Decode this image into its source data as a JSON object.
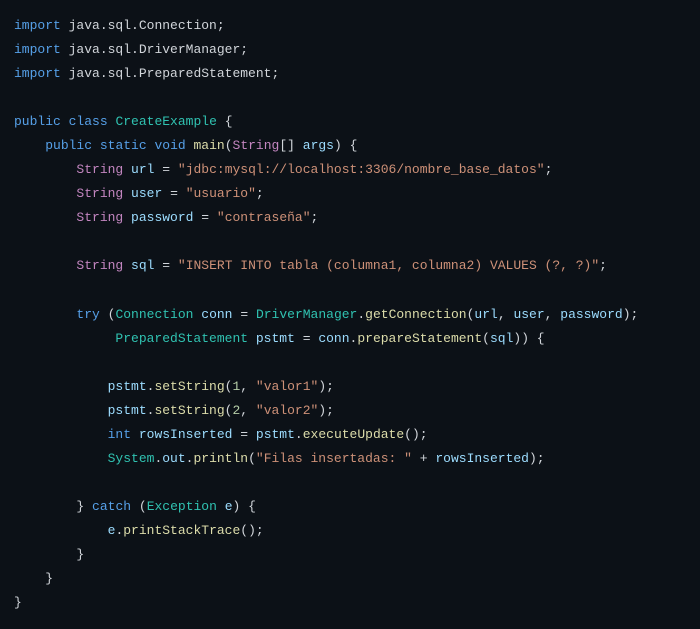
{
  "code": {
    "import1_pkg": "java.sql.Connection",
    "import2_pkg": "java.sql.DriverManager",
    "import3_pkg": "java.sql.PreparedStatement",
    "kw_import": "import",
    "kw_public": "public",
    "kw_class": "class",
    "kw_static": "static",
    "kw_void": "void",
    "kw_try": "try",
    "kw_catch": "catch",
    "kw_int": "int",
    "classname": "CreateExample",
    "main_name": "main",
    "string_type": "String",
    "args_name": "args",
    "var_url": "url",
    "var_user": "user",
    "var_password": "password",
    "var_sql": "sql",
    "var_conn": "conn",
    "var_pstmt": "pstmt",
    "var_rows": "rowsInserted",
    "var_e": "e",
    "cls_connection": "Connection",
    "cls_drivermanager": "DriverManager",
    "cls_prepstmt": "PreparedStatement",
    "cls_exception": "Exception",
    "cls_system": "System",
    "fld_out": "out",
    "m_getconn": "getConnection",
    "m_prepstmt": "prepareStatement",
    "m_setstring": "setString",
    "m_execupd": "executeUpdate",
    "m_println": "println",
    "m_printstack": "printStackTrace",
    "str_url": "\"jdbc:mysql://localhost:3306/nombre_base_datos\"",
    "str_user": "\"usuario\"",
    "str_password": "\"contraseña\"",
    "str_sql": "\"INSERT INTO tabla (columna1, columna2) VALUES (?, ?)\"",
    "str_valor1": "\"valor1\"",
    "str_valor2": "\"valor2\"",
    "str_filas": "\"Filas insertadas: \"",
    "num_1": "1",
    "num_2": "2"
  }
}
